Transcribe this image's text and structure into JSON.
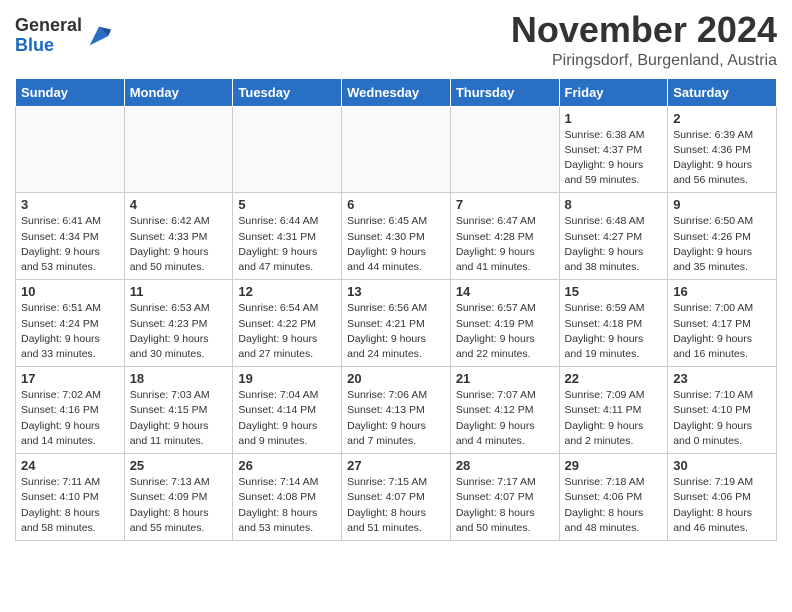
{
  "header": {
    "logo_general": "General",
    "logo_blue": "Blue",
    "month_title": "November 2024",
    "subtitle": "Piringsdorf, Burgenland, Austria"
  },
  "calendar": {
    "headers": [
      "Sunday",
      "Monday",
      "Tuesday",
      "Wednesday",
      "Thursday",
      "Friday",
      "Saturday"
    ],
    "weeks": [
      [
        {
          "day": "",
          "info": ""
        },
        {
          "day": "",
          "info": ""
        },
        {
          "day": "",
          "info": ""
        },
        {
          "day": "",
          "info": ""
        },
        {
          "day": "",
          "info": ""
        },
        {
          "day": "1",
          "info": "Sunrise: 6:38 AM\nSunset: 4:37 PM\nDaylight: 9 hours\nand 59 minutes."
        },
        {
          "day": "2",
          "info": "Sunrise: 6:39 AM\nSunset: 4:36 PM\nDaylight: 9 hours\nand 56 minutes."
        }
      ],
      [
        {
          "day": "3",
          "info": "Sunrise: 6:41 AM\nSunset: 4:34 PM\nDaylight: 9 hours\nand 53 minutes."
        },
        {
          "day": "4",
          "info": "Sunrise: 6:42 AM\nSunset: 4:33 PM\nDaylight: 9 hours\nand 50 minutes."
        },
        {
          "day": "5",
          "info": "Sunrise: 6:44 AM\nSunset: 4:31 PM\nDaylight: 9 hours\nand 47 minutes."
        },
        {
          "day": "6",
          "info": "Sunrise: 6:45 AM\nSunset: 4:30 PM\nDaylight: 9 hours\nand 44 minutes."
        },
        {
          "day": "7",
          "info": "Sunrise: 6:47 AM\nSunset: 4:28 PM\nDaylight: 9 hours\nand 41 minutes."
        },
        {
          "day": "8",
          "info": "Sunrise: 6:48 AM\nSunset: 4:27 PM\nDaylight: 9 hours\nand 38 minutes."
        },
        {
          "day": "9",
          "info": "Sunrise: 6:50 AM\nSunset: 4:26 PM\nDaylight: 9 hours\nand 35 minutes."
        }
      ],
      [
        {
          "day": "10",
          "info": "Sunrise: 6:51 AM\nSunset: 4:24 PM\nDaylight: 9 hours\nand 33 minutes."
        },
        {
          "day": "11",
          "info": "Sunrise: 6:53 AM\nSunset: 4:23 PM\nDaylight: 9 hours\nand 30 minutes."
        },
        {
          "day": "12",
          "info": "Sunrise: 6:54 AM\nSunset: 4:22 PM\nDaylight: 9 hours\nand 27 minutes."
        },
        {
          "day": "13",
          "info": "Sunrise: 6:56 AM\nSunset: 4:21 PM\nDaylight: 9 hours\nand 24 minutes."
        },
        {
          "day": "14",
          "info": "Sunrise: 6:57 AM\nSunset: 4:19 PM\nDaylight: 9 hours\nand 22 minutes."
        },
        {
          "day": "15",
          "info": "Sunrise: 6:59 AM\nSunset: 4:18 PM\nDaylight: 9 hours\nand 19 minutes."
        },
        {
          "day": "16",
          "info": "Sunrise: 7:00 AM\nSunset: 4:17 PM\nDaylight: 9 hours\nand 16 minutes."
        }
      ],
      [
        {
          "day": "17",
          "info": "Sunrise: 7:02 AM\nSunset: 4:16 PM\nDaylight: 9 hours\nand 14 minutes."
        },
        {
          "day": "18",
          "info": "Sunrise: 7:03 AM\nSunset: 4:15 PM\nDaylight: 9 hours\nand 11 minutes."
        },
        {
          "day": "19",
          "info": "Sunrise: 7:04 AM\nSunset: 4:14 PM\nDaylight: 9 hours\nand 9 minutes."
        },
        {
          "day": "20",
          "info": "Sunrise: 7:06 AM\nSunset: 4:13 PM\nDaylight: 9 hours\nand 7 minutes."
        },
        {
          "day": "21",
          "info": "Sunrise: 7:07 AM\nSunset: 4:12 PM\nDaylight: 9 hours\nand 4 minutes."
        },
        {
          "day": "22",
          "info": "Sunrise: 7:09 AM\nSunset: 4:11 PM\nDaylight: 9 hours\nand 2 minutes."
        },
        {
          "day": "23",
          "info": "Sunrise: 7:10 AM\nSunset: 4:10 PM\nDaylight: 9 hours\nand 0 minutes."
        }
      ],
      [
        {
          "day": "24",
          "info": "Sunrise: 7:11 AM\nSunset: 4:10 PM\nDaylight: 8 hours\nand 58 minutes."
        },
        {
          "day": "25",
          "info": "Sunrise: 7:13 AM\nSunset: 4:09 PM\nDaylight: 8 hours\nand 55 minutes."
        },
        {
          "day": "26",
          "info": "Sunrise: 7:14 AM\nSunset: 4:08 PM\nDaylight: 8 hours\nand 53 minutes."
        },
        {
          "day": "27",
          "info": "Sunrise: 7:15 AM\nSunset: 4:07 PM\nDaylight: 8 hours\nand 51 minutes."
        },
        {
          "day": "28",
          "info": "Sunrise: 7:17 AM\nSunset: 4:07 PM\nDaylight: 8 hours\nand 50 minutes."
        },
        {
          "day": "29",
          "info": "Sunrise: 7:18 AM\nSunset: 4:06 PM\nDaylight: 8 hours\nand 48 minutes."
        },
        {
          "day": "30",
          "info": "Sunrise: 7:19 AM\nSunset: 4:06 PM\nDaylight: 8 hours\nand 46 minutes."
        }
      ]
    ]
  }
}
